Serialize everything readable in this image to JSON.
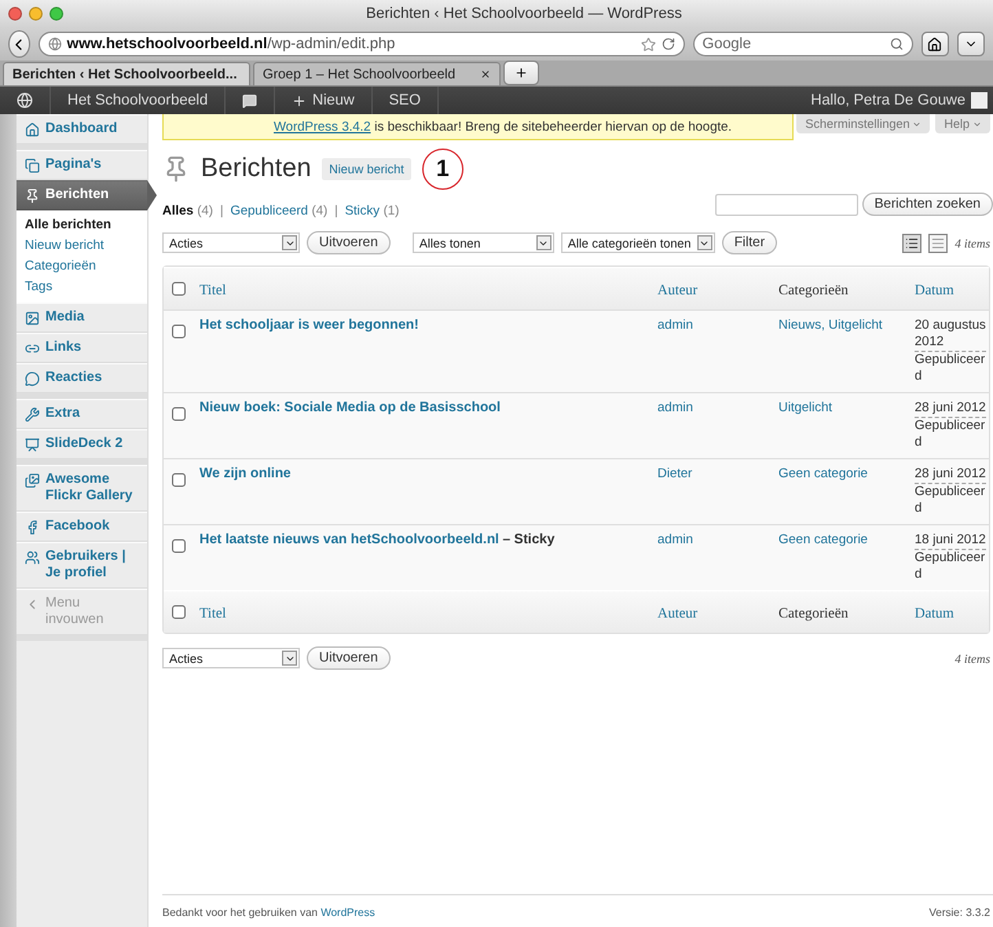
{
  "window": {
    "title": "Berichten ‹ Het Schoolvoorbeeld — WordPress"
  },
  "browser": {
    "url_host": "www.hetschoolvoorbeeld.nl",
    "url_path": "/wp-admin/edit.php",
    "search_placeholder": "Google",
    "tabs": [
      {
        "label": "Berichten ‹ Het Schoolvoorbeeld...",
        "selected": true
      },
      {
        "label": "Groep 1 – Het Schoolvoorbeeld",
        "selected": false
      }
    ]
  },
  "admin_bar": {
    "site": "Het Schoolvoorbeeld",
    "new": "Nieuw",
    "seo": "SEO",
    "greeting": "Hallo, Petra De Gouwe"
  },
  "notice": {
    "link": "WordPress 3.4.2",
    "text": " is beschikbaar! Breng de sitebeheerder hiervan op de hoogte."
  },
  "screen_buttons": [
    "Scherminstellingen",
    "Help"
  ],
  "sidebar": {
    "groups": [
      [
        {
          "label": "Dashboard",
          "selected": false
        }
      ],
      [
        {
          "label": "Pagina's",
          "selected": false
        },
        {
          "label": "Berichten",
          "selected": true,
          "children": [
            {
              "label": "Alle berichten",
              "selected": true
            },
            {
              "label": "Nieuw bericht",
              "selected": false
            },
            {
              "label": "Categorieën",
              "selected": false
            },
            {
              "label": "Tags",
              "selected": false
            }
          ]
        },
        {
          "label": "Media",
          "selected": false
        },
        {
          "label": "Links",
          "selected": false
        },
        {
          "label": "Reacties",
          "selected": false
        }
      ],
      [
        {
          "label": "Extra",
          "selected": false
        },
        {
          "label": "SlideDeck 2",
          "selected": false
        }
      ],
      [
        {
          "label": "Awesome Flickr Gallery",
          "selected": false
        },
        {
          "label": "Facebook",
          "selected": false
        },
        {
          "label": "Gebruikers | Je profiel",
          "selected": false
        },
        {
          "label": "Menu invouwen",
          "kind": "collapse",
          "selected": false
        }
      ]
    ]
  },
  "page": {
    "title": "Berichten",
    "add_button": "Nieuw bericht",
    "callout": "1",
    "filters": [
      {
        "label": "Alles",
        "count": "(4)",
        "selected": true
      },
      {
        "separator": "|",
        "label": "Gepubliceerd",
        "count": "(4)",
        "selected": false
      },
      {
        "separator": "|",
        "label": "Sticky",
        "count": "(1)",
        "selected": false
      }
    ],
    "search_button": "Berichten zoeken",
    "bulk_select": "Acties",
    "apply_button": "Uitvoeren",
    "date_select": "Alles tonen",
    "category_select": "Alle categorieën tonen",
    "filter_button": "Filter",
    "view_modes": [
      {
        "kind": "list",
        "selected": true
      },
      {
        "kind": "excerpt",
        "selected": false
      }
    ],
    "item_count": "4 items",
    "select_all": {
      "checked": false
    },
    "columns": [
      {
        "label": "Titel",
        "sortable": true
      },
      {
        "label": "Auteur",
        "sortable": true
      },
      {
        "label": "Categorieën",
        "sortable": false
      },
      {
        "label": "Datum",
        "sortable": true
      }
    ],
    "rows": [
      {
        "title": "Het schooljaar is weer begonnen!",
        "author": "admin",
        "categories": "Nieuws, Uitgelicht",
        "date": "20 augustus 2012",
        "status": "Gepubliceerd",
        "checked": false
      },
      {
        "title": "Nieuw boek: Sociale Media op de Basisschool",
        "author": "admin",
        "categories": "Uitgelicht",
        "date": "28 juni 2012",
        "status": "Gepubliceerd",
        "checked": false
      },
      {
        "title": "We zijn online",
        "author": "Dieter",
        "categories": "Geen categorie",
        "date": "28 juni 2012",
        "status": "Gepubliceerd",
        "checked": false
      },
      {
        "title": "Het laatste nieuws van hetSchoolvoorbeeld.nl",
        "suffix": "– Sticky",
        "author": "admin",
        "categories": "Geen categorie",
        "date": "18 juni 2012",
        "status": "Gepubliceerd",
        "checked": false
      }
    ],
    "footer_select_all": {
      "checked": false
    },
    "footer_columns": [
      {
        "label": "Titel",
        "sortable": true
      },
      {
        "label": "Auteur",
        "sortable": true
      },
      {
        "label": "Categorieën",
        "sortable": false
      },
      {
        "label": "Datum",
        "sortable": true
      }
    ],
    "bottom_bulk_select": "Acties",
    "bottom_apply_button": "Uitvoeren",
    "bottom_item_count": "4 items"
  },
  "footer": {
    "thanks": "Bedankt voor het gebruiken van",
    "link": "WordPress",
    "version": "Versie: 3.3.2"
  }
}
